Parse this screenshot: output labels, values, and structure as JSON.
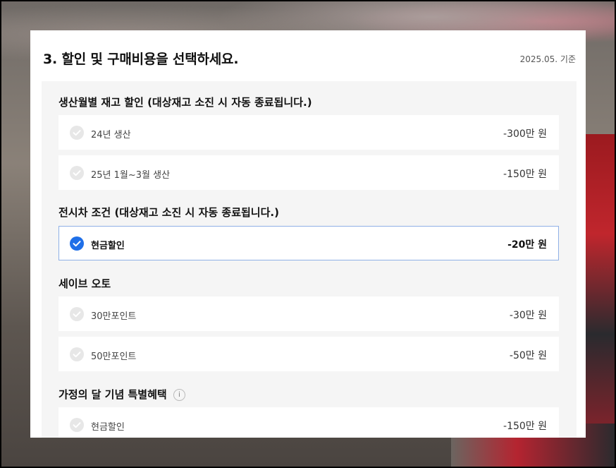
{
  "header": {
    "title": "3. 할인 및 구매비용을 선택하세요.",
    "basis_date": "2025.05. 기준"
  },
  "sections": [
    {
      "title": "생산월별 재고 할인 (대상재고 소진 시 자동 종료됩니다.)",
      "options": [
        {
          "label": "24년 생산",
          "price": "-300만 원",
          "selected": false
        },
        {
          "label": "25년 1월~3월 생산",
          "price": "-150만 원",
          "selected": false
        }
      ]
    },
    {
      "title": "전시차 조건 (대상재고 소진 시 자동 종료됩니다.)",
      "options": [
        {
          "label": "현금할인",
          "price": "-20만 원",
          "selected": true
        }
      ]
    },
    {
      "title": "세이브 오토",
      "options": [
        {
          "label": "30만포인트",
          "price": "-30만 원",
          "selected": false
        },
        {
          "label": "50만포인트",
          "price": "-50만 원",
          "selected": false
        }
      ]
    },
    {
      "title": "가정의 달 기념 특별혜택",
      "info_icon": "i",
      "options": [
        {
          "label": "현금할인",
          "price": "-150만 원",
          "selected": false
        }
      ]
    }
  ],
  "colors": {
    "accent": "#1f6fe8",
    "selected_border": "#8fb0e6",
    "content_bg": "#f5f5f5"
  }
}
